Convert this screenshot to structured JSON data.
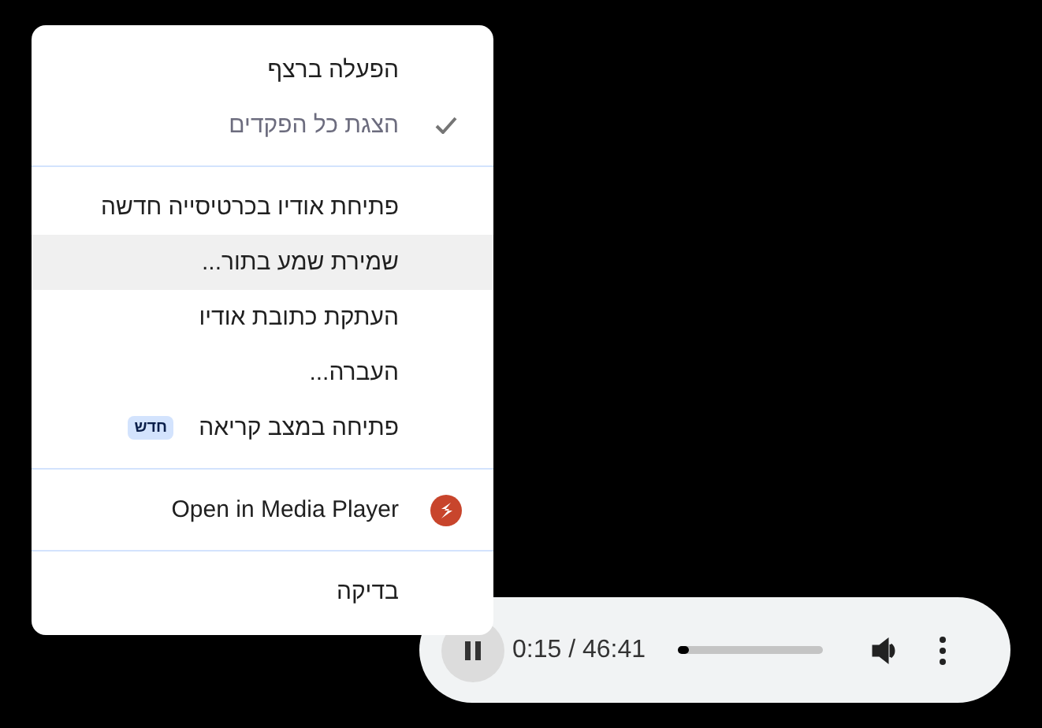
{
  "menu": {
    "sections": [
      [
        {
          "label": "הפעלה ברצף",
          "kind": "plain",
          "checked": false,
          "disabled": false,
          "highlighted": false
        },
        {
          "label": "הצגת כל הפקדים",
          "kind": "plain",
          "checked": true,
          "disabled": true,
          "highlighted": false
        }
      ],
      [
        {
          "label": "פתיחת אודיו בכרטיסייה חדשה",
          "kind": "plain",
          "checked": false,
          "disabled": false,
          "highlighted": false
        },
        {
          "label": "שמירת שמע בתור...",
          "kind": "plain",
          "checked": false,
          "disabled": false,
          "highlighted": true
        },
        {
          "label": "העתקת כתובת אודיו",
          "kind": "plain",
          "checked": false,
          "disabled": false,
          "highlighted": false
        },
        {
          "label": "העברה...",
          "kind": "plain",
          "checked": false,
          "disabled": false,
          "highlighted": false
        },
        {
          "label": "פתיחה במצב קריאה",
          "kind": "badge",
          "badge": "חדש",
          "checked": false,
          "disabled": false,
          "highlighted": false
        }
      ],
      [
        {
          "label": "Open in Media Player",
          "kind": "app",
          "checked": false,
          "disabled": false,
          "highlighted": false
        }
      ],
      [
        {
          "label": "בדיקה",
          "kind": "plain",
          "checked": false,
          "disabled": false,
          "highlighted": false
        }
      ]
    ]
  },
  "player": {
    "playing": true,
    "time": "0:15 / 46:41",
    "level": 0.03
  }
}
